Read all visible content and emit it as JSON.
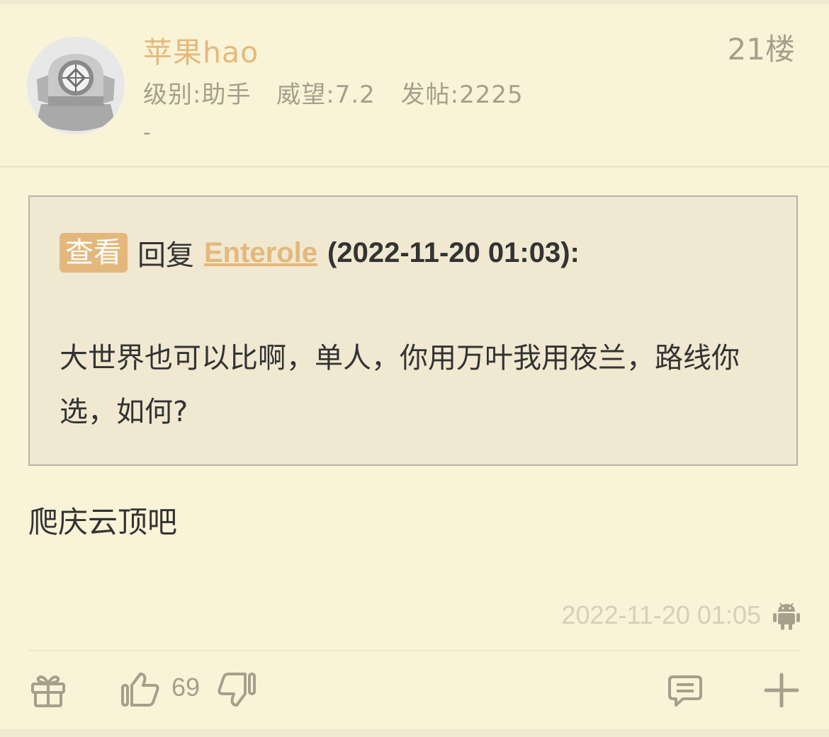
{
  "user": {
    "name": "苹果hao",
    "level": "级别:助手",
    "prestige": "威望:7.2",
    "posts": "发帖:2225",
    "signature": "-"
  },
  "floor": "21楼",
  "quote": {
    "view_label": "查看",
    "reply_word": "回复",
    "reply_user": "Enterole",
    "reply_time": "(2022-11-20 01:03):",
    "body": "大世界也可以比啊，单人，你用万叶我用夜兰，路线你选，如何?"
  },
  "post": {
    "content": "爬庆云顶吧",
    "timestamp": "2022-11-20 01:05"
  },
  "actions": {
    "like_count": "69"
  },
  "icons": {
    "avatar": "diving-helmet-avatar",
    "device": "android-icon",
    "gift": "gift-icon",
    "like": "thumbs-up-icon",
    "dislike": "thumbs-down-icon",
    "comment": "comment-icon",
    "more": "plus-icon"
  },
  "colors": {
    "background": "#f9f4d8",
    "accent": "#e4b87c",
    "muted": "#a69f8c",
    "quote_bg": "#f0e8d1"
  }
}
